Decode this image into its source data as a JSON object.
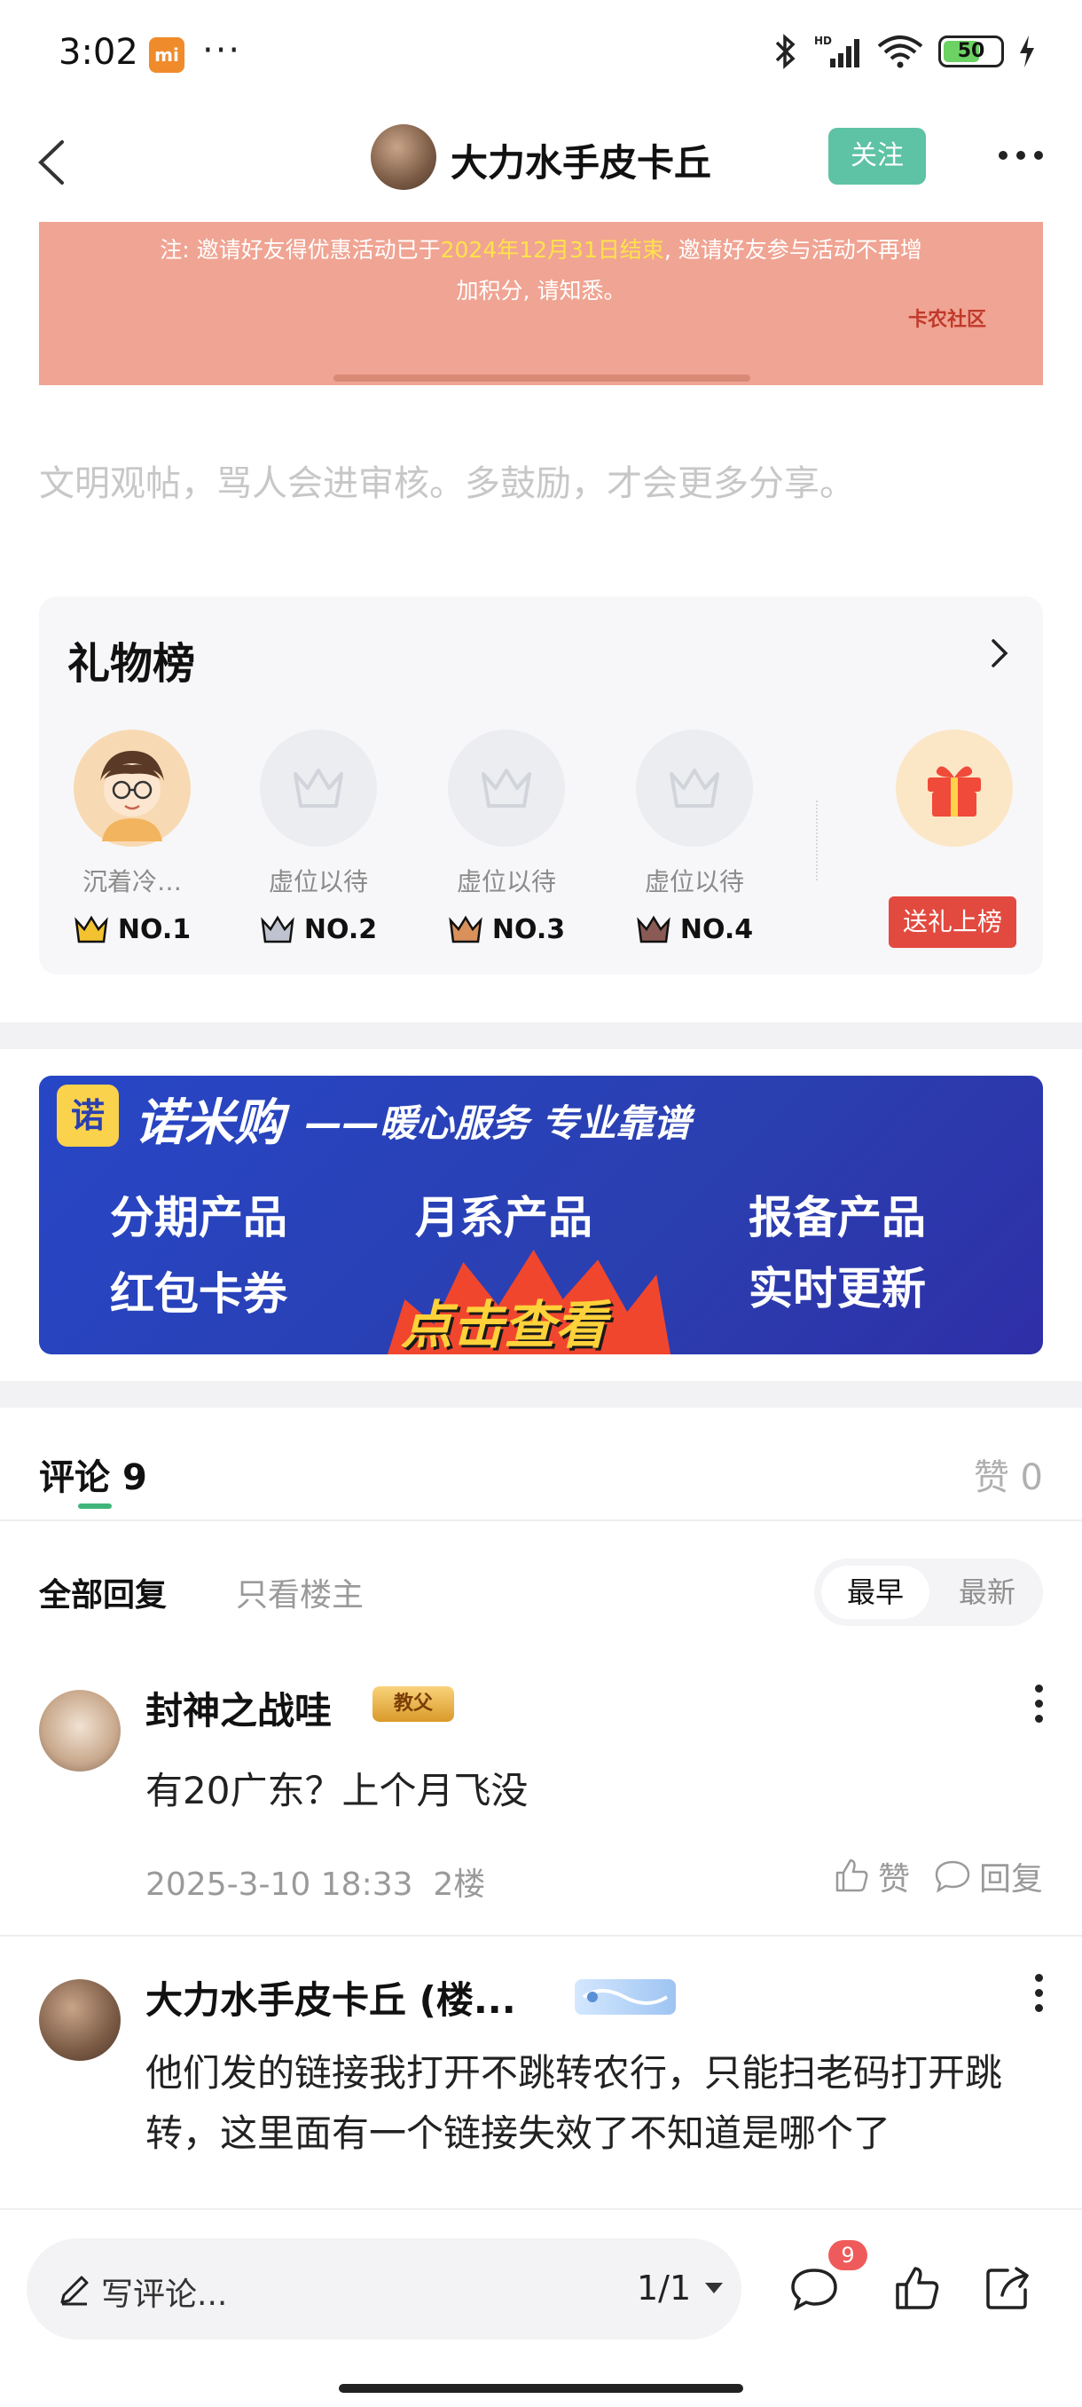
{
  "status_bar": {
    "time": "3:02",
    "battery": "50"
  },
  "header": {
    "author": "大力水手皮卡丘",
    "follow_label": "关注"
  },
  "promo": {
    "line1_prefix": "注: 邀请好友得优惠活动已于",
    "line1_highlight": "2024年12月31日结束",
    "line1_suffix": ", 邀请好友参与活动不再增",
    "line2": "加积分, 请知悉。",
    "logo": "卡农社区"
  },
  "civil_notice": "文明观帖，骂人会进审核。多鼓励，才会更多分享。",
  "gift_list": {
    "title": "礼物榜",
    "slots": [
      {
        "name": "沉着冷…",
        "rank": "NO.1",
        "crown_color": "#f2c230"
      },
      {
        "name": "虚位以待",
        "rank": "NO.2",
        "crown_color": "#bfc3cf"
      },
      {
        "name": "虚位以待",
        "rank": "NO.3",
        "crown_color": "#d9905a"
      },
      {
        "name": "虚位以待",
        "rank": "NO.4",
        "crown_color": "#8a5a55"
      }
    ],
    "send_label": "送礼上榜"
  },
  "ad": {
    "logo": "诺",
    "brand": "诺米购",
    "tagline": "——暖心服务 专业靠谱",
    "items": [
      "分期产品",
      "月系产品",
      "报备产品",
      "红包卡券",
      "实时更新"
    ],
    "cta": "点击查看"
  },
  "comments_header": {
    "label": "评论",
    "count": "9",
    "likes": "赞 0"
  },
  "filter": {
    "all": "全部回复",
    "op_only": "只看楼主",
    "sort_early": "最早",
    "sort_new": "最新"
  },
  "comments": [
    {
      "user": "封神之战哇",
      "badge": "教父",
      "text": "有20广东？上个月飞没",
      "time": "2025-3-10 18:33",
      "floor": "2楼",
      "like_label": "赞",
      "reply_label": "回复"
    },
    {
      "user": "大力水手皮卡丘 (楼...",
      "badge": "",
      "text": "他们发的链接我打开不跳转农行，只能扫老码打开跳转，这里面有一个链接失效了不知道是哪个了"
    }
  ],
  "bottom_bar": {
    "write_placeholder": "写评论...",
    "pager": "1/1",
    "comment_badge": "9"
  }
}
